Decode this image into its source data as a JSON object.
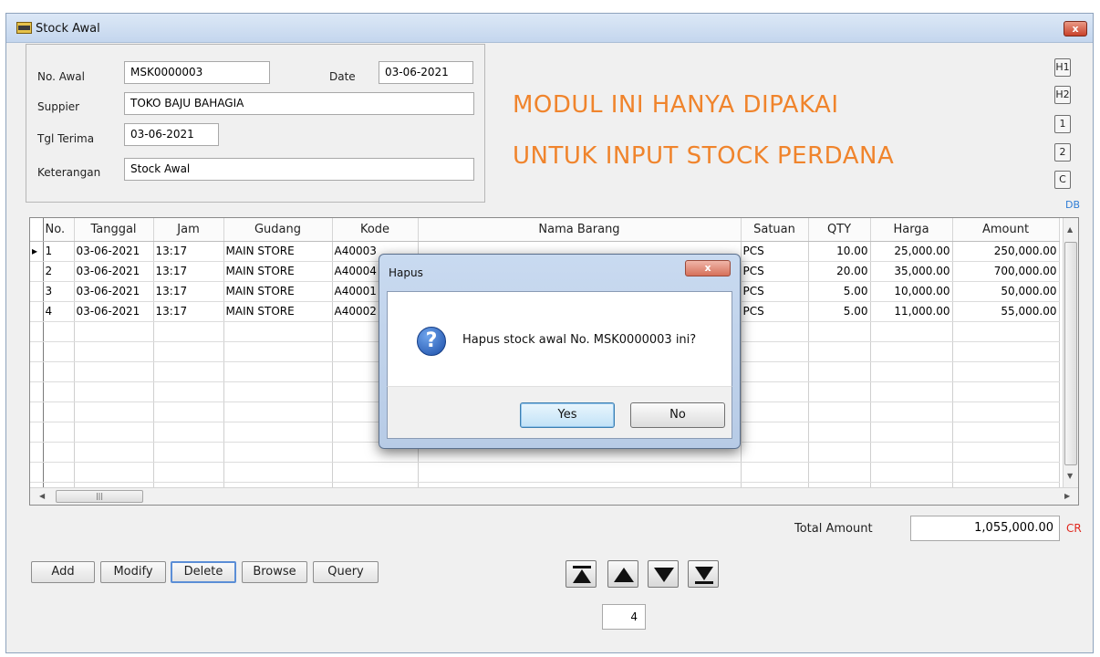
{
  "window": {
    "title": "Stock Awal",
    "close_label": "x"
  },
  "form": {
    "no_awal_label": "No. Awal",
    "no_awal_value": "MSK0000003",
    "date_label": "Date",
    "date_value": "03-06-2021",
    "supplier_label": "Suppier",
    "supplier_value": "TOKO BAJU BAHAGIA",
    "tgl_terima_label": "Tgl Terima",
    "tgl_terima_value": "03-06-2021",
    "keterangan_label": "Keterangan",
    "keterangan_value": "Stock Awal"
  },
  "notice": {
    "line1": "MODUL INI HANYA DIPAKAI",
    "line2": "UNTUK INPUT STOCK PERDANA"
  },
  "side_buttons": [
    "H1",
    "H2",
    "1",
    "2",
    "C"
  ],
  "db_label": "DB",
  "grid": {
    "columns": [
      "No.",
      "Tanggal",
      "Jam",
      "Gudang",
      "Kode",
      "Nama Barang",
      "Satuan",
      "QTY",
      "Harga",
      "Amount"
    ],
    "rows": [
      [
        "1",
        "03-06-2021",
        "13:17",
        "MAIN STORE",
        "A40003",
        "",
        "PCS",
        "10.00",
        "25,000.00",
        "250,000.00"
      ],
      [
        "2",
        "03-06-2021",
        "13:17",
        "MAIN STORE",
        "A40004",
        "",
        "PCS",
        "20.00",
        "35,000.00",
        "700,000.00"
      ],
      [
        "3",
        "03-06-2021",
        "13:17",
        "MAIN STORE",
        "A40001",
        "",
        "PCS",
        "5.00",
        "10,000.00",
        "50,000.00"
      ],
      [
        "4",
        "03-06-2021",
        "13:17",
        "MAIN STORE",
        "A40002",
        "",
        "PCS",
        "5.00",
        "11,000.00",
        "55,000.00"
      ]
    ]
  },
  "total": {
    "label": "Total Amount",
    "value": "1,055,000.00",
    "suffix": "CR"
  },
  "actions": {
    "add": "Add",
    "modify": "Modify",
    "delete": "Delete",
    "browse": "Browse",
    "query": "Query"
  },
  "nav": {
    "record_number": "4"
  },
  "dialog": {
    "title": "Hapus",
    "close_label": "x",
    "message": "Hapus stock awal No. MSK0000003 ini?",
    "yes_label": "Yes",
    "no_label": "No"
  }
}
